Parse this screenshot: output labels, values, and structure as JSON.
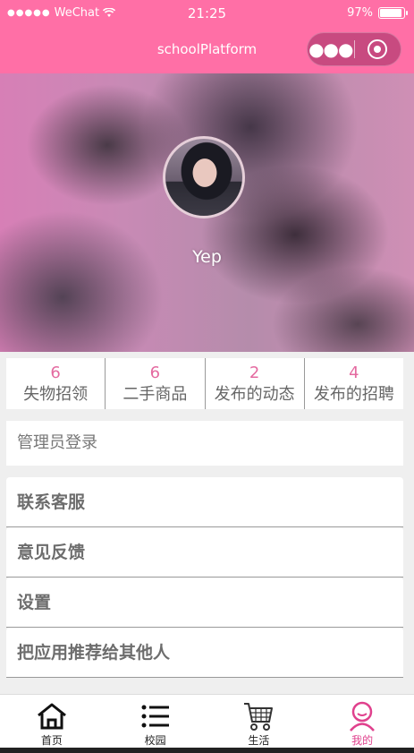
{
  "status_bar": {
    "carrier": "WeChat",
    "time": "21:25",
    "battery": "97%",
    "battery_level": 0.97
  },
  "nav": {
    "title": "schoolPlatform",
    "more_icon": "ellipsis-icon",
    "close_icon": "target-icon"
  },
  "profile": {
    "username": "Yep"
  },
  "stats": [
    {
      "value": "6",
      "label": "失物招领"
    },
    {
      "value": "6",
      "label": "二手商品"
    },
    {
      "value": "2",
      "label": "发布的动态"
    },
    {
      "value": "4",
      "label": "发布的招聘"
    }
  ],
  "admin_login": "管理员登录",
  "menu": [
    {
      "label": "联系客服"
    },
    {
      "label": "意见反馈"
    },
    {
      "label": "设置"
    },
    {
      "label": "把应用推荐给其他人"
    }
  ],
  "tabs": [
    {
      "label": "首页",
      "icon": "home-icon"
    },
    {
      "label": "校园",
      "icon": "list-icon"
    },
    {
      "label": "生活",
      "icon": "cart-icon"
    },
    {
      "label": "我的",
      "icon": "user-icon",
      "active": true
    }
  ],
  "colors": {
    "brand": "#ff6fa6",
    "accent": "#e46aa0",
    "active_tab": "#e0418d"
  }
}
